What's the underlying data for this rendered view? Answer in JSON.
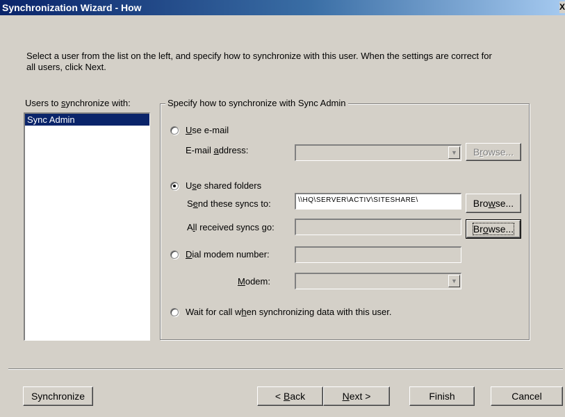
{
  "window": {
    "title": "Synchronization Wizard - How",
    "close_glyph": "X"
  },
  "intro": "Select a user from the list on the left, and specify how to synchronize with this user. When the settings are correct for all users, click Next.",
  "users": {
    "label": "Users to synchronize with:",
    "items": [
      "Sync Admin"
    ],
    "selected": "Sync Admin"
  },
  "group": {
    "legend": "Specify how to synchronize with Sync Admin",
    "email": {
      "option_label": "Use e-mail",
      "checked": false,
      "address_label": "E-mail address:",
      "address_value": "",
      "browse_label": "Browse..."
    },
    "shared": {
      "option_label": "Use shared folders",
      "checked": true,
      "send_label": "Send these syncs to:",
      "send_value": "\\\\HQ\\SERVER\\ACTIV\\SITESHARE\\",
      "send_browse_label": "Browse...",
      "received_label": "All received syncs go:",
      "received_value": "",
      "received_browse_label": "Browse..."
    },
    "modem": {
      "option_label": "Dial modem number:",
      "checked": false,
      "number_value": "",
      "modem_label": "Modem:",
      "modem_value": ""
    },
    "wait": {
      "option_label": "Wait for call when synchronizing data with this user.",
      "checked": false
    }
  },
  "footer": {
    "synchronize_label": "Synchronize",
    "back_label": "< Back",
    "next_label": "Next >",
    "finish_label": "Finish",
    "cancel_label": "Cancel"
  }
}
